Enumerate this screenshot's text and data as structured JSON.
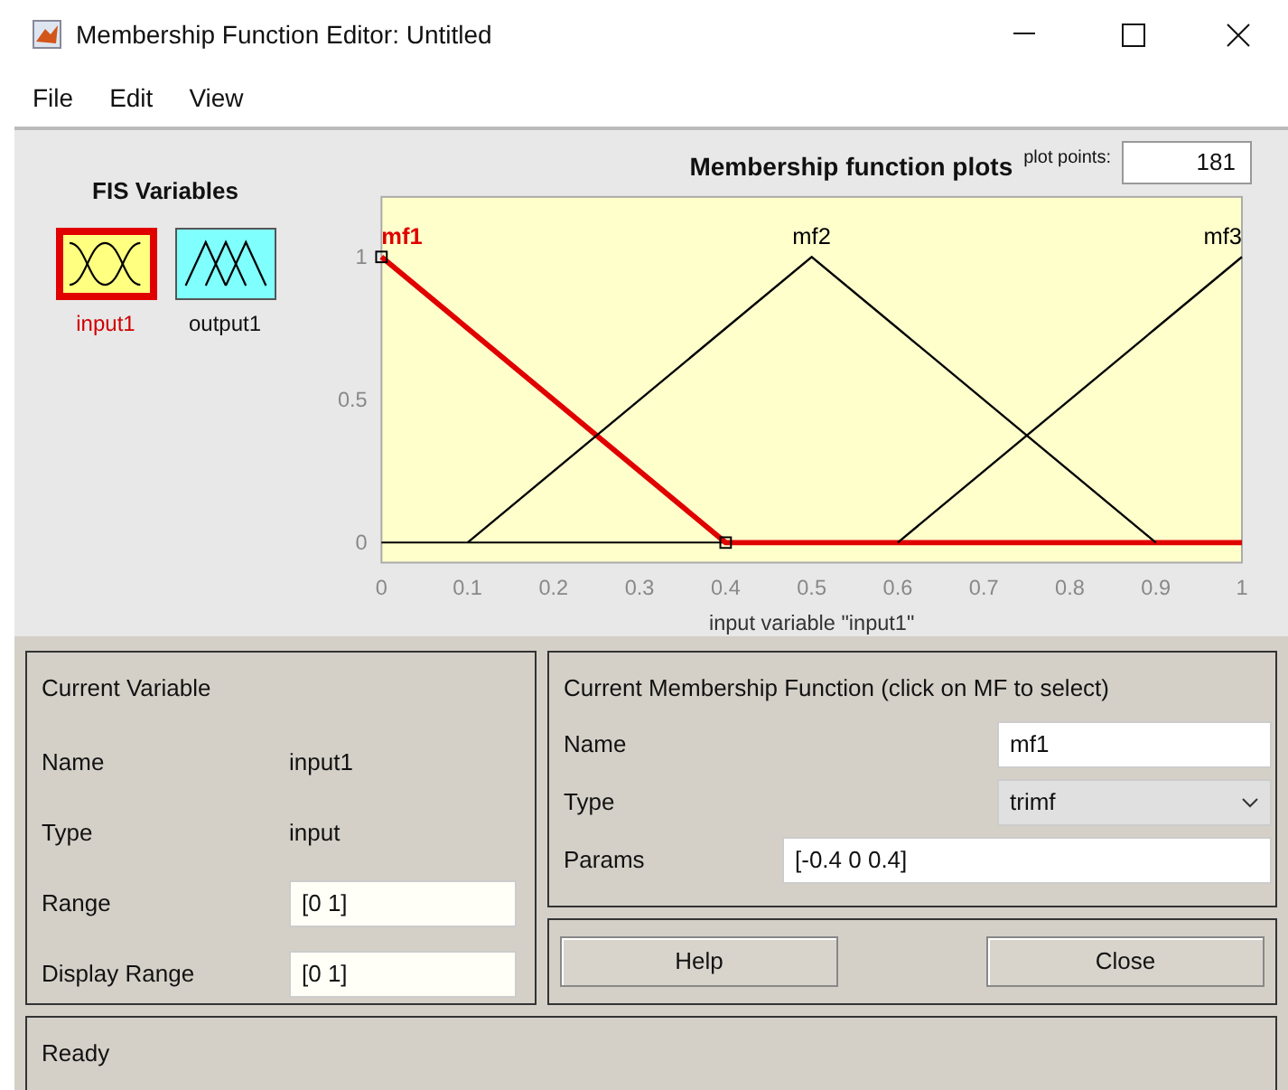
{
  "window": {
    "title": "Membership Function Editor: Untitled"
  },
  "menu": [
    "File",
    "Edit",
    "View"
  ],
  "fis_variables": {
    "title": "FIS Variables",
    "items": [
      {
        "label": "input1",
        "kind": "input",
        "selected": true
      },
      {
        "label": "output1",
        "kind": "output",
        "selected": false
      }
    ]
  },
  "plot": {
    "title": "Membership function plots",
    "plot_points_label": "plot points:",
    "plot_points": "181",
    "chart_data": {
      "type": "line",
      "xlabel": "input variable \"input1\"",
      "x": [
        0,
        0.1,
        0.4,
        0.5,
        0.6,
        0.9,
        1
      ],
      "series": [
        {
          "name": "mf1",
          "color": "#e00000",
          "values": [
            1,
            0.75,
            0,
            0,
            0,
            0,
            0
          ]
        },
        {
          "name": "mf2",
          "color": "#000000",
          "values": [
            null,
            0,
            0.75,
            1,
            0.75,
            0,
            null
          ]
        },
        {
          "name": "mf3",
          "color": "#000000",
          "values": [
            null,
            null,
            null,
            null,
            0,
            0.75,
            1
          ]
        }
      ],
      "xlim": [
        0,
        1
      ],
      "ylim": [
        -0.07,
        1.21
      ],
      "xticks": [
        0,
        0.1,
        0.2,
        0.3,
        0.4,
        0.5,
        0.6,
        0.7,
        0.8,
        0.9,
        1
      ],
      "yticks": [
        0,
        0.5,
        1
      ]
    },
    "curves": [
      {
        "selected": true
      },
      {
        "selected": false
      },
      {
        "selected": false
      }
    ]
  },
  "current_variable": {
    "title": "Current Variable",
    "rows": [
      {
        "label": "Name",
        "value": "input1",
        "kind": "text"
      },
      {
        "label": "Type",
        "value": "input",
        "kind": "text"
      },
      {
        "label": "Range",
        "value": "[0 1]",
        "kind": "field"
      },
      {
        "label": "Display Range",
        "value": "[0 1]",
        "kind": "field"
      }
    ]
  },
  "current_mf": {
    "title": "Current Membership Function (click on MF to select)",
    "name_label": "Name",
    "name": "mf1",
    "type_label": "Type",
    "type": "trimf",
    "params_label": "Params",
    "params": "[-0.4 0 0.4]"
  },
  "buttons": [
    "Help",
    "Close"
  ],
  "status": "Ready"
}
